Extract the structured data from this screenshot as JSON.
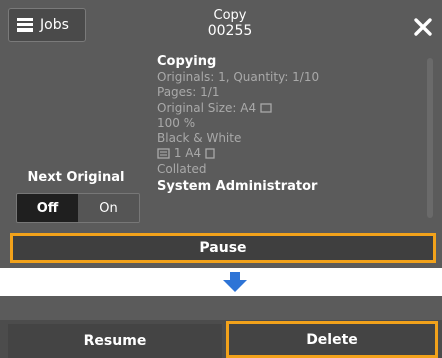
{
  "header": {
    "jobs_label": "Jobs",
    "job_type": "Copy",
    "job_number": "00255"
  },
  "details": {
    "status": "Copying",
    "lines": [
      "Originals: 1, Quantity: 1/10",
      "Pages: 1/1",
      "Original Size: A4",
      "100 %",
      "Black & White",
      "1 A4",
      "Collated"
    ],
    "owner": "System Administrator"
  },
  "next_original": {
    "label": "Next Original",
    "off_label": "Off",
    "on_label": "On",
    "selected": "Off"
  },
  "actions": {
    "pause_label": "Pause",
    "resume_label": "Resume",
    "delete_label": "Delete"
  },
  "colors": {
    "panel_bg": "#5b5b5b",
    "highlight": "#f2a21b",
    "arrow": "#2e74d6"
  },
  "icons": {
    "jobs": "jobs-icon",
    "close": "close-icon",
    "original_orientation": "portrait-page-icon",
    "paper_tray": "paper-tray-icon",
    "down_arrow": "arrow-down-icon"
  }
}
